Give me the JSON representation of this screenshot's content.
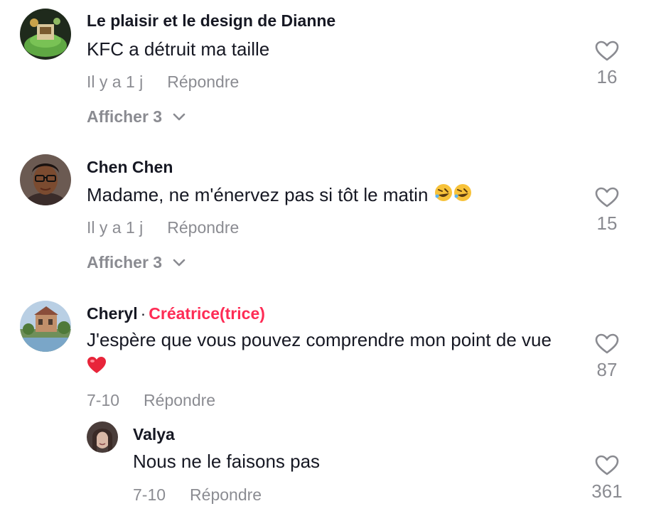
{
  "comments": [
    {
      "author": "Le plaisir et le design de Dianne",
      "text": "KFC a détruit ma taille",
      "time": "Il y a 1 j",
      "reply": "Répondre",
      "expand": "Afficher 3",
      "likes": "16"
    },
    {
      "author": "Chen Chen",
      "text": "Madame, ne m'énervez pas si tôt le matin",
      "emoji": "🤣🤣",
      "emoji_icon": "rolling-laughing-emoji",
      "time": "Il y a 1 j",
      "reply": "Répondre",
      "expand": "Afficher 3",
      "likes": "15"
    },
    {
      "author": "Cheryl",
      "separator": "·",
      "badge": "Créatrice(trice)",
      "text": "J'espère que vous pouvez comprendre mon point de vue",
      "emoji": "❤️",
      "emoji_icon": "red-heart-emoji",
      "time": "7-10",
      "reply": "Répondre",
      "likes": "87"
    }
  ],
  "reply_comment": {
    "author": "Valya",
    "text": "Nous ne le faisons pas",
    "time": "7-10",
    "reply": "Répondre",
    "likes": "361"
  },
  "colors": {
    "primary_text": "#161823",
    "secondary_text": "rgba(22,24,35,0.5)",
    "creator_badge": "#fe2c55"
  },
  "icons": {
    "like": "heart-outline-icon",
    "expand": "chevron-down-icon"
  }
}
